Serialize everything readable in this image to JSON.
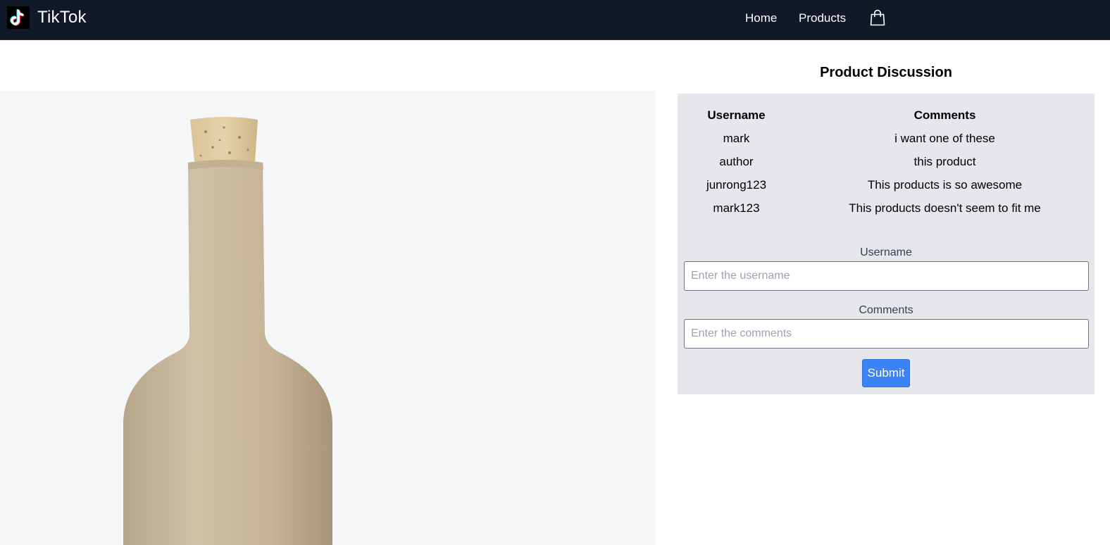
{
  "navbar": {
    "brand": "TikTok",
    "links": [
      "Home",
      "Products"
    ],
    "logo_icon": "tiktok-logo-icon",
    "cart_icon": "shopping-bag-icon",
    "background_color": "#111827"
  },
  "product": {
    "image_alt": "ceramic bottle with cork stopper"
  },
  "discussion": {
    "title": "Product Discussion",
    "table": {
      "headers": [
        "Username",
        "Comments"
      ],
      "rows": [
        {
          "username": "mark",
          "comment": "i want one of these"
        },
        {
          "username": "author",
          "comment": "this product"
        },
        {
          "username": "junrong123",
          "comment": "This products is so awesome"
        },
        {
          "username": "mark123",
          "comment": "This products doesn't seem to fit me"
        }
      ]
    },
    "form": {
      "username_label": "Username",
      "username_placeholder": "Enter the username",
      "username_value": "",
      "comments_label": "Comments",
      "comments_placeholder": "Enter the comments",
      "comments_value": "",
      "submit_label": "Submit",
      "submit_color": "#3b82f6"
    },
    "panel_color": "#e5e7eb"
  }
}
